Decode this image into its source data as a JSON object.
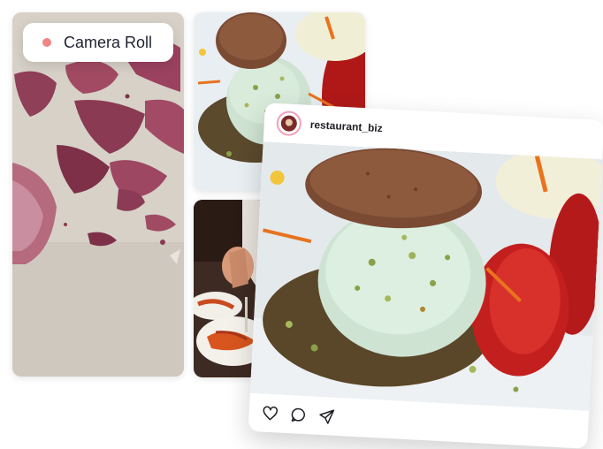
{
  "camera_roll": {
    "label": "Camera Roll",
    "dot_color": "#f08585"
  },
  "photos": [
    {
      "subject": "red onion peels on countertop"
    },
    {
      "subject": "pistachio gelato with cookie and strawberry"
    },
    {
      "subject": "chef plating shrimp dishes"
    }
  ],
  "post": {
    "username": "restaurant_biz",
    "avatar_icon": "restaurant-avatar",
    "image_subject": "pistachio gelato with cookie and strawberry",
    "actions": [
      {
        "name": "like",
        "icon": "heart-icon"
      },
      {
        "name": "comment",
        "icon": "comment-icon"
      },
      {
        "name": "share",
        "icon": "send-icon"
      }
    ]
  }
}
